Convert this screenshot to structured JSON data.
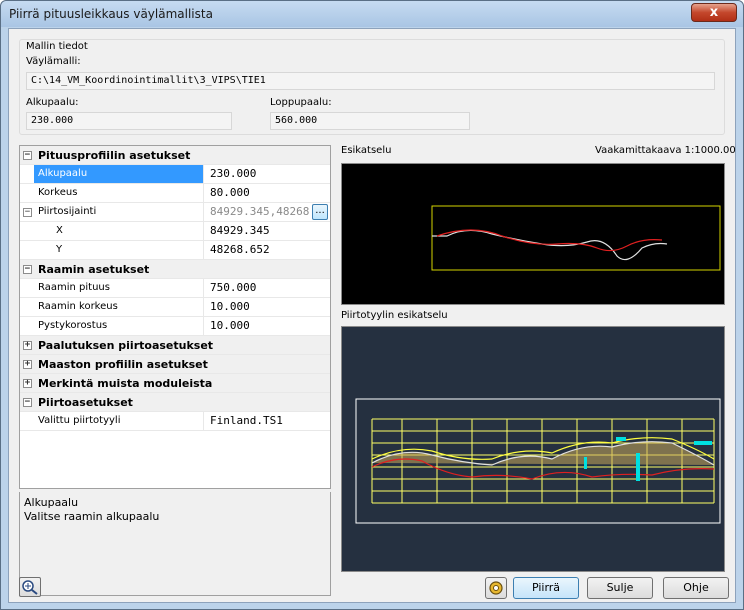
{
  "window": {
    "title": "Piirrä pituusleikkaus väylämallista",
    "close_label": "x"
  },
  "model": {
    "group_label": "Mallin tiedot",
    "vaylamalli_label": "Väylämalli:",
    "vaylamalli_value": "C:\\14_VM_Koordinointimallit\\3_VIPS\\TIE1",
    "alkupaalu_label": "Alkupaalu:",
    "alkupaalu_value": "230.000",
    "loppupaalu_label": "Loppupaalu:",
    "loppupaalu_value": "560.000"
  },
  "properties": {
    "cat_pituus": "Pituusprofiilin asetukset",
    "alkupaalu_name": "Alkupaalu",
    "alkupaalu_value": "230.000",
    "korkeus_name": "Korkeus",
    "korkeus_value": "80.000",
    "piirtosijainti_name": "Piirtosijainti",
    "piirtosijainti_value": "84929.345,48268.652",
    "x_name": "X",
    "x_value": "84929.345",
    "y_name": "Y",
    "y_value": "48268.652",
    "cat_raami": "Raamin asetukset",
    "raamin_pituus_name": "Raamin pituus",
    "raamin_pituus_value": "750.000",
    "raamin_korkeus_name": "Raamin korkeus",
    "raamin_korkeus_value": "10.000",
    "pystykorostus_name": "Pystykorostus",
    "pystykorostus_value": "10.000",
    "cat_paalutus": "Paalutuksen piirtoasetukset",
    "cat_maasto": "Maaston profiilin asetukset",
    "cat_merkinta": "Merkintä muista moduleista",
    "cat_piirto": "Piirtoasetukset",
    "piirtotyyli_name": "Valittu piirtotyyli",
    "piirtotyyli_value": "Finland.TS1",
    "expand_plus": "+",
    "expand_minus": "−",
    "ellipsis": "..."
  },
  "description": {
    "title": "Alkupaalu",
    "text": "Valitse raamin alkupaalu"
  },
  "preview": {
    "label": "Esikatselu",
    "scale_label": "Vaakamittakaava 1:1000.00",
    "style_label": "Piirtotyylin esikatselu"
  },
  "buttons": {
    "piirra": "Piirrä",
    "sulje": "Sulje",
    "ohje": "Ohje"
  },
  "icons": {
    "zoom": "zoom-icon",
    "settings": "settings-icon",
    "close": "close-icon"
  },
  "colors": {
    "accent": "#3399ff",
    "preview_frame": "#d4d400",
    "profile_red": "#e02020",
    "profile_white": "#e0e0e0"
  }
}
